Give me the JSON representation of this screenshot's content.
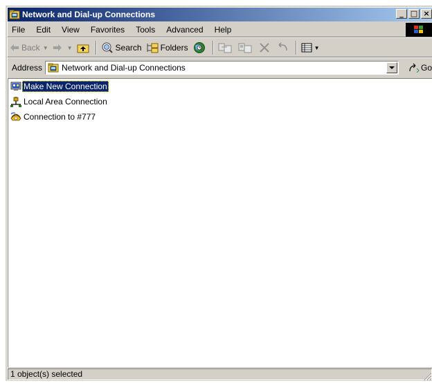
{
  "window": {
    "title": "Network and Dial-up Connections",
    "title_buttons": {
      "minimize": "_",
      "maximize": "□",
      "close": "×"
    }
  },
  "menu": [
    "File",
    "Edit",
    "View",
    "Favorites",
    "Tools",
    "Advanced",
    "Help"
  ],
  "toolbar": {
    "back_label": "Back",
    "search_label": "Search",
    "folders_label": "Folders"
  },
  "address": {
    "label": "Address",
    "value": "Network and Dial-up Connections",
    "go_label": "Go"
  },
  "items": [
    {
      "label": "Make New Connection",
      "icon": "make-new-connection-icon",
      "selected": true
    },
    {
      "label": "Local Area Connection",
      "icon": "lan-connection-icon",
      "selected": false
    },
    {
      "label": "Connection to #777",
      "icon": "dialup-connection-icon",
      "selected": false
    }
  ],
  "status": {
    "text": "1 object(s) selected"
  },
  "colors": {
    "title_start": "#0a246a",
    "title_end": "#a6caf0",
    "selection": "#0a246a",
    "face": "#d4d0c8"
  }
}
